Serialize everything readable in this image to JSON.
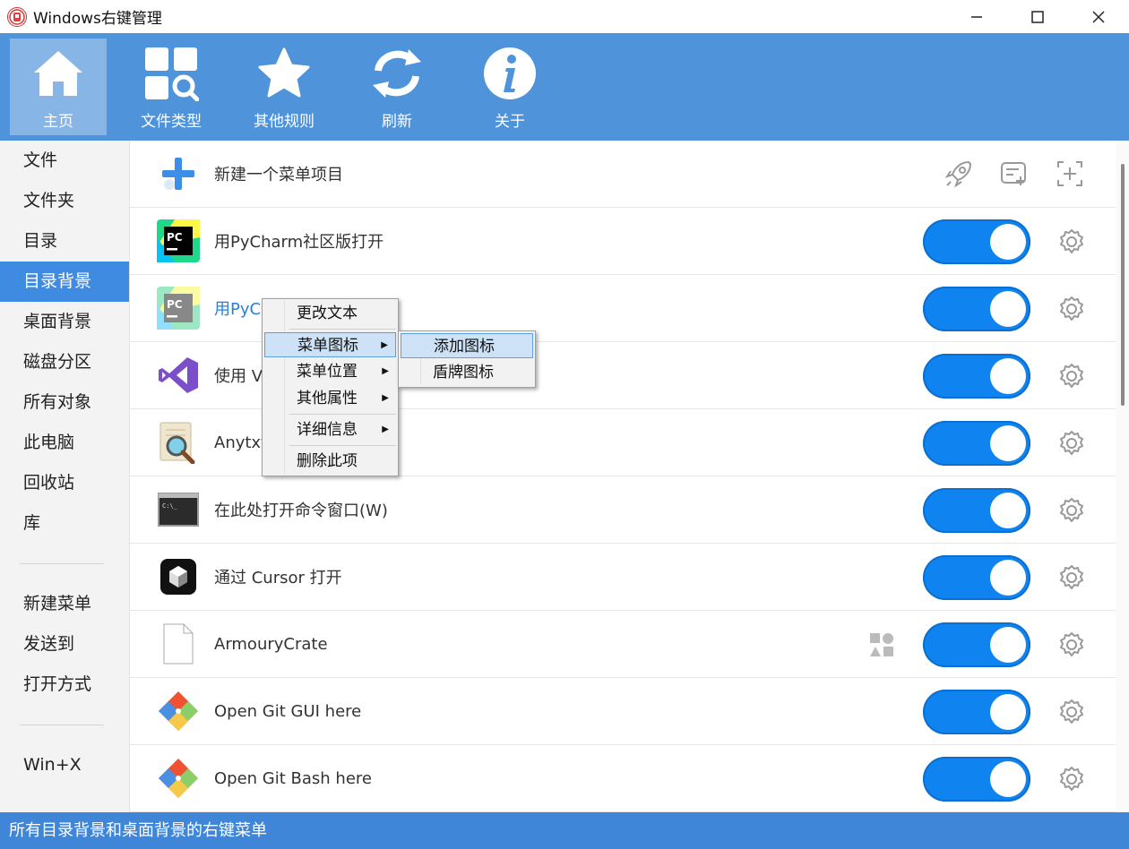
{
  "window": {
    "title": "Windows右键管理",
    "icon": "app-logo-icon",
    "controls": [
      "minimize-icon",
      "maximize-icon",
      "close-icon"
    ]
  },
  "toolbar": [
    {
      "label": "主页",
      "icon": "home-icon",
      "active": true
    },
    {
      "label": "文件类型",
      "icon": "file-type-search-icon",
      "active": false
    },
    {
      "label": "其他规则",
      "icon": "star-icon",
      "active": false
    },
    {
      "label": "刷新",
      "icon": "refresh-icon",
      "active": false
    },
    {
      "label": "关于",
      "icon": "info-icon",
      "active": false
    }
  ],
  "sidebar": {
    "group1": [
      "文件",
      "文件夹",
      "目录",
      "目录背景",
      "桌面背景",
      "磁盘分区",
      "所有对象",
      "此电脑",
      "回收站",
      "库"
    ],
    "group2": [
      "新建菜单",
      "发送到",
      "打开方式"
    ],
    "group3": [
      "Win+X"
    ],
    "active": "目录背景"
  },
  "list": {
    "header": {
      "label": "新建一个菜单项目",
      "icon": "plus-icon",
      "actions": [
        "rocket-icon",
        "note-add-icon",
        "crosshair-add-icon"
      ]
    },
    "rows": [
      {
        "label": "用PyCharm社区版打开",
        "icon": "pycharm-icon",
        "enabled": true
      },
      {
        "label": "用PyC",
        "icon": "pycharm-faded-icon",
        "enabled": true,
        "highlighted": true
      },
      {
        "label": "使用 V",
        "icon": "visual-studio-icon",
        "enabled": true
      },
      {
        "label": "Anytxt",
        "icon": "anytxt-search-icon",
        "enabled": true
      },
      {
        "label": "在此处打开命令窗口(W)",
        "icon": "cmd-icon",
        "enabled": true
      },
      {
        "label": "通过 Cursor 打开",
        "icon": "cursor-icon",
        "enabled": true
      },
      {
        "label": "ArmouryCrate",
        "icon": "blank-file-icon",
        "enabled": true,
        "extra_icon": "shapes-icon"
      },
      {
        "label": "Open Git GUI here",
        "icon": "git-icon",
        "enabled": true
      },
      {
        "label": "Open Git Bash here",
        "icon": "git-icon",
        "enabled": true
      }
    ]
  },
  "context_menu": {
    "items": [
      {
        "label": "更改文本",
        "submenu": false
      },
      {
        "label": "菜单图标",
        "submenu": true,
        "highlighted": true
      },
      {
        "label": "菜单位置",
        "submenu": true
      },
      {
        "label": "其他属性",
        "submenu": true
      },
      {
        "label": "详细信息",
        "submenu": true
      },
      {
        "label": "删除此项",
        "submenu": false
      }
    ],
    "submenu": [
      {
        "label": "添加图标",
        "highlighted": true
      },
      {
        "label": "盾牌图标"
      }
    ]
  },
  "status": {
    "text": "所有目录背景和桌面背景的右键菜单"
  },
  "colors": {
    "toolbar": "#4f93db",
    "accent": "#3f8be2",
    "toggle": "#0f84f0",
    "status": "#3f86d8"
  }
}
